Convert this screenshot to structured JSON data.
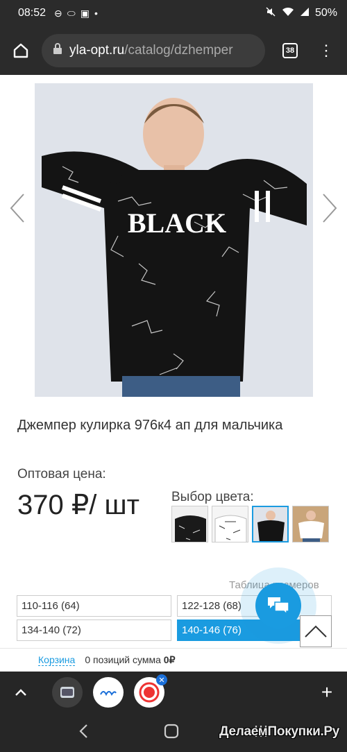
{
  "status_bar": {
    "time": "08:52",
    "battery": "50%"
  },
  "browser": {
    "url_domain": "yla-opt.ru",
    "url_path": "/catalog/dzhemper",
    "tab_count": "38"
  },
  "product": {
    "image_text": "BLACK",
    "title": "Джемпер кулирка 976к4 ап для мальчика",
    "price_label": "Оптовая цена:",
    "price": "370 ₽/ шт",
    "color_label": "Выбор цвета:",
    "selected_color_index": 2,
    "size_table_label": "Таблица размеров",
    "sizes": [
      {
        "label": "110-116 (64)"
      },
      {
        "label": "122-128 (68)"
      },
      {
        "label": "134-140 (72)"
      },
      {
        "label": "140-146 (76)"
      }
    ],
    "selected_size_index": 3
  },
  "cart": {
    "link": "Корзина",
    "info_prefix": "0 позиций сумма ",
    "sum": "0₽"
  },
  "colors": {
    "accent": "#1a9be0",
    "dark_bar": "#2b2b2b"
  },
  "watermark": "ДелаемПокупки.Ру"
}
